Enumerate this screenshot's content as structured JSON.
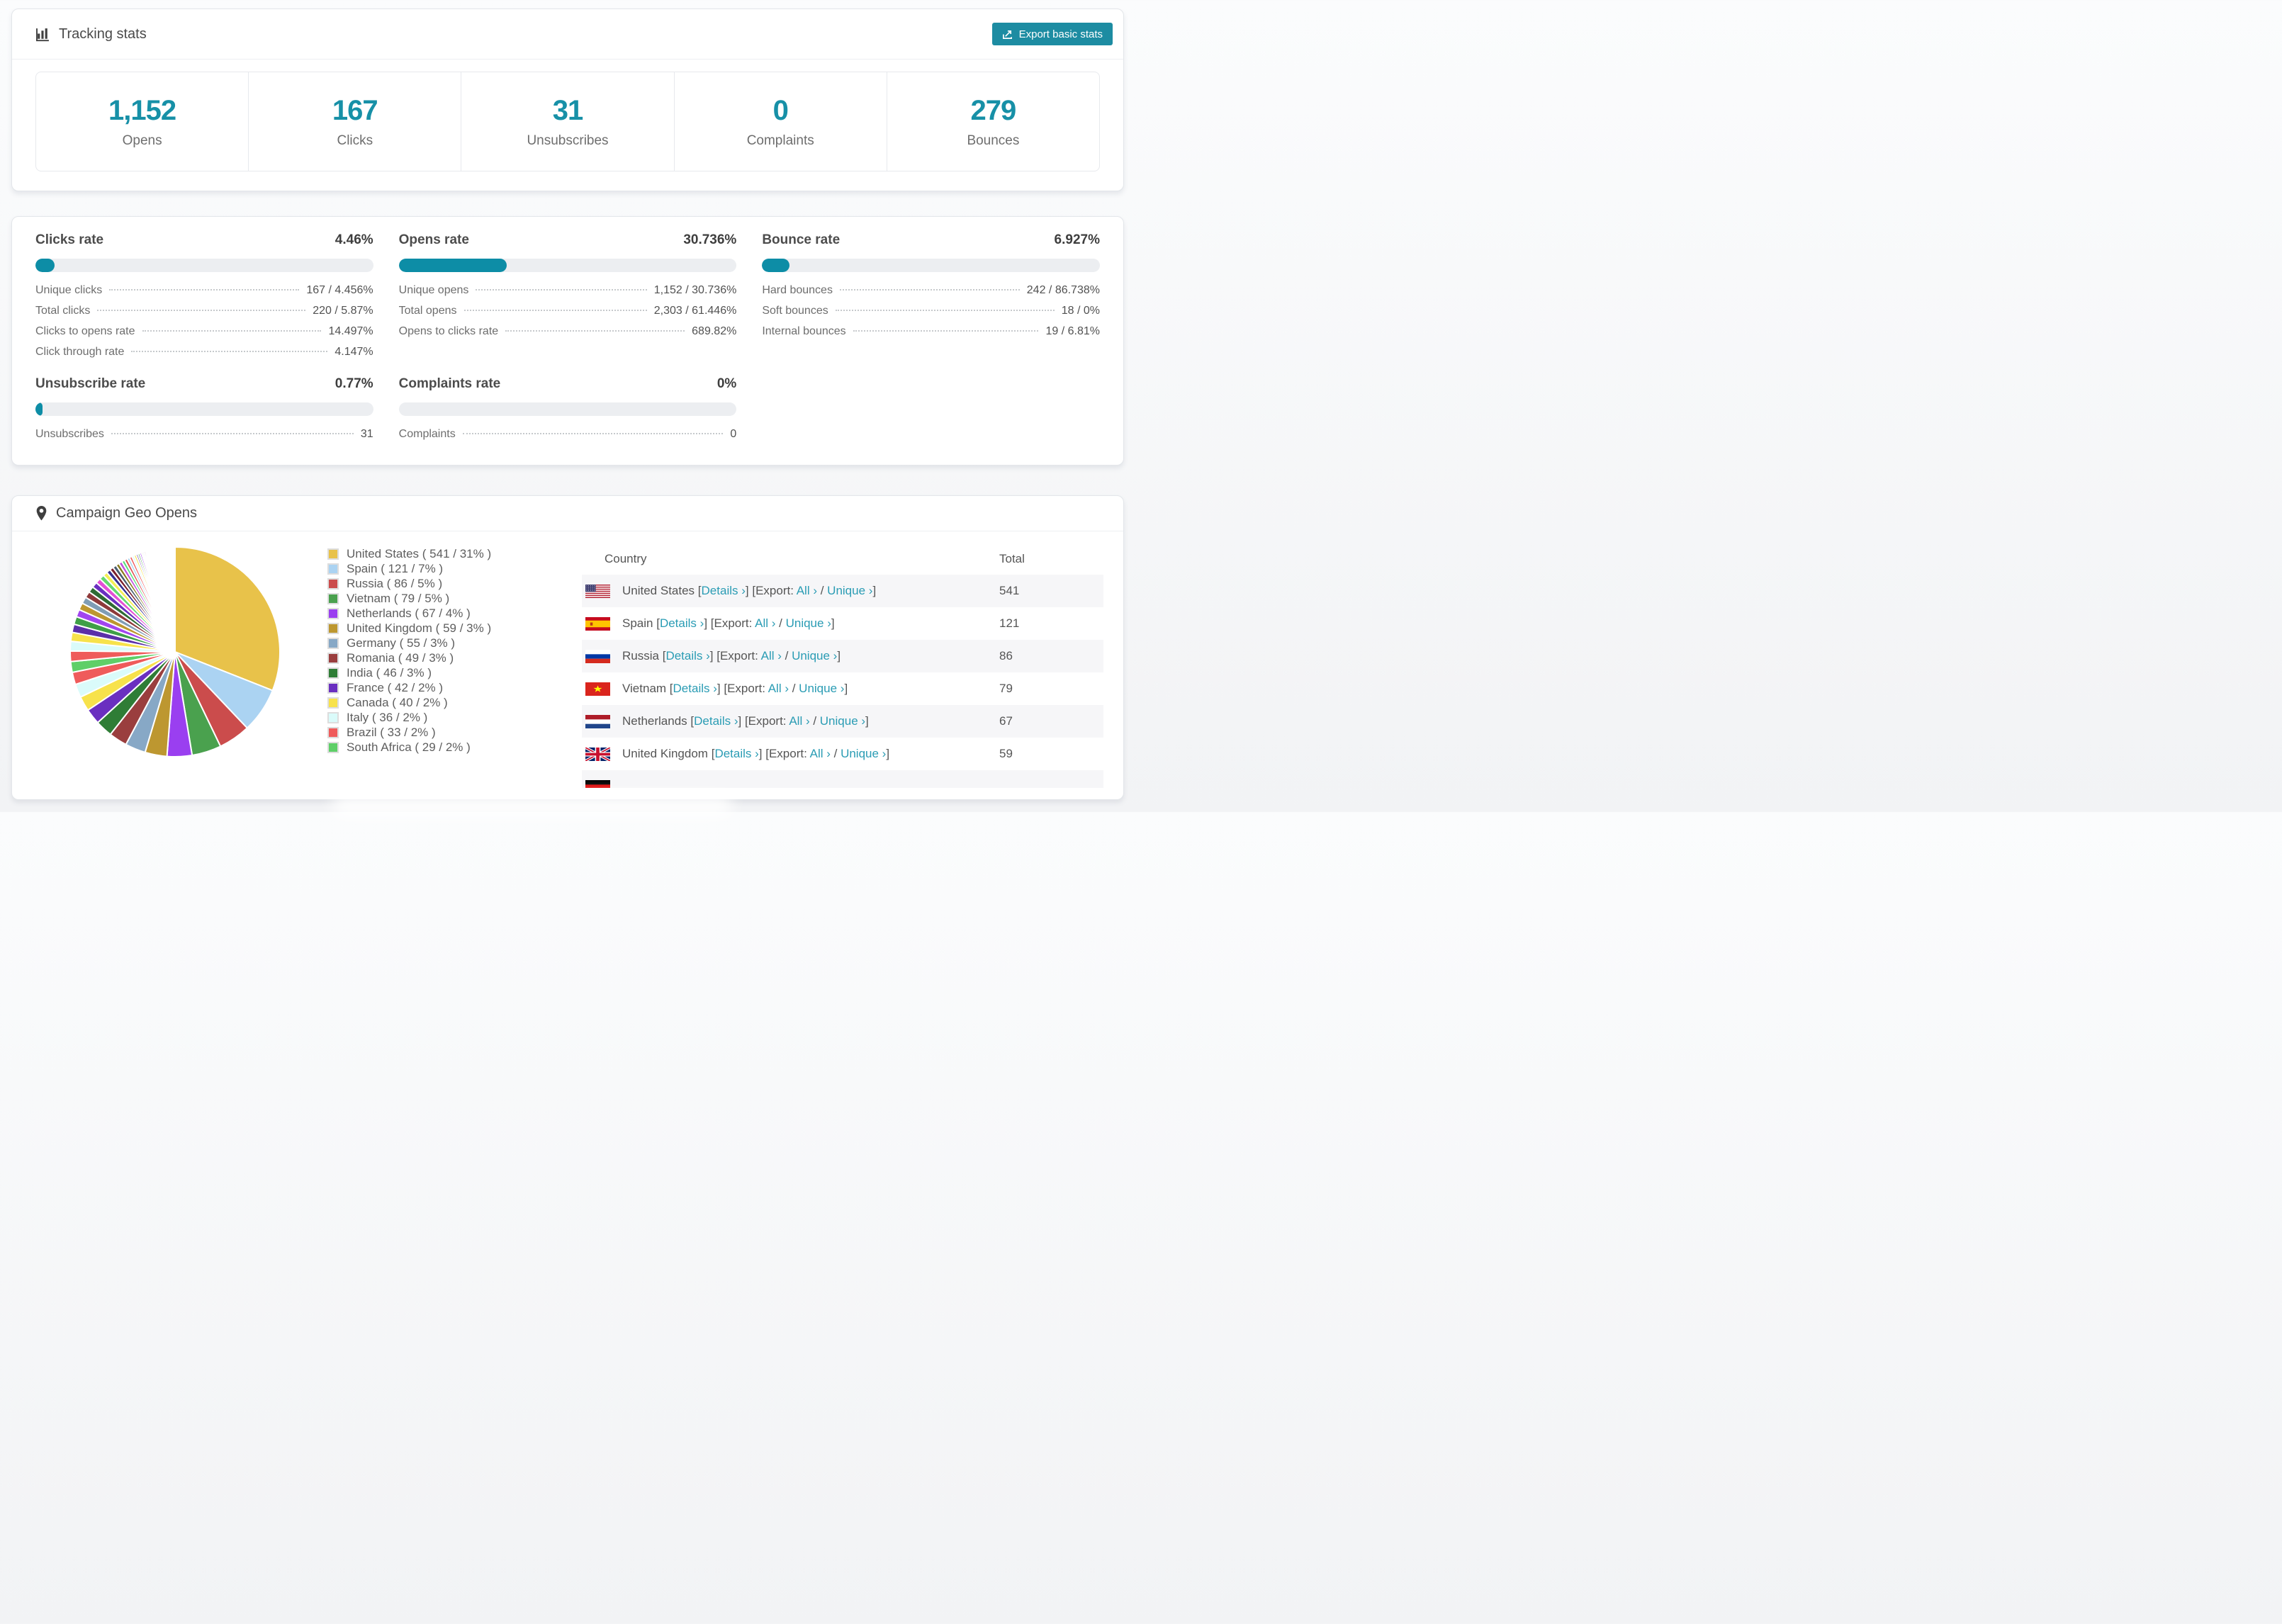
{
  "colors": {
    "accent": "#1790a7",
    "link": "#2a9cb4",
    "bar_fill": "#0d8da6",
    "bar_track": "#eceef1",
    "button_bg": "#1d8ca2",
    "row_alt_bg": "#f6f6f8"
  },
  "tracking": {
    "title": "Tracking stats",
    "export_button": {
      "label": "Export basic stats"
    },
    "summary": [
      {
        "value": "1,152",
        "label": "Opens"
      },
      {
        "value": "167",
        "label": "Clicks"
      },
      {
        "value": "31",
        "label": "Unsubscribes"
      },
      {
        "value": "0",
        "label": "Complaints"
      },
      {
        "value": "279",
        "label": "Bounces"
      }
    ]
  },
  "rates": [
    {
      "title": "Clicks rate",
      "value": "4.46%",
      "percent": 4.46,
      "rows": [
        {
          "label": "Unique clicks",
          "value": "167 / 4.456%"
        },
        {
          "label": "Total clicks",
          "value": "220 / 5.87%"
        },
        {
          "label": "Clicks to opens rate",
          "value": "14.497%"
        },
        {
          "label": "Click through rate",
          "value": "4.147%"
        }
      ]
    },
    {
      "title": "Opens rate",
      "value": "30.736%",
      "percent": 30.736,
      "rows": [
        {
          "label": "Unique opens",
          "value": "1,152 / 30.736%"
        },
        {
          "label": "Total opens",
          "value": "2,303 / 61.446%"
        },
        {
          "label": "Opens to clicks rate",
          "value": "689.82%"
        }
      ]
    },
    {
      "title": "Bounce rate",
      "value": "6.927%",
      "percent": 6.927,
      "rows": [
        {
          "label": "Hard bounces",
          "value": "242 / 86.738%"
        },
        {
          "label": "Soft bounces",
          "value": "18 / 0%"
        },
        {
          "label": "Internal bounces",
          "value": "19 / 6.81%"
        }
      ]
    },
    {
      "title": "Unsubscribe rate",
      "value": "0.77%",
      "percent": 0.77,
      "rows": [
        {
          "label": "Unsubscribes",
          "value": "31"
        }
      ]
    },
    {
      "title": "Complaints rate",
      "value": "0%",
      "percent": 0,
      "rows": [
        {
          "label": "Complaints",
          "value": "0"
        }
      ]
    }
  ],
  "geo": {
    "title": "Campaign Geo Opens",
    "legend": [
      {
        "label": "United States ( 541 / 31% )",
        "color": "#e8c24a"
      },
      {
        "label": "Spain ( 121 / 7% )",
        "color": "#abd3f2"
      },
      {
        "label": "Russia ( 86 / 5% )",
        "color": "#cb4c4c"
      },
      {
        "label": "Vietnam ( 79 / 5% )",
        "color": "#4aa14e"
      },
      {
        "label": "Netherlands ( 67 / 4% )",
        "color": "#9a3ff0"
      },
      {
        "label": "United Kingdom ( 59 / 3% )",
        "color": "#bd9730"
      },
      {
        "label": "Germany ( 55 / 3% )",
        "color": "#87a8c6"
      },
      {
        "label": "Romania ( 49 / 3% )",
        "color": "#9a3e3e"
      },
      {
        "label": "India ( 46 / 3% )",
        "color": "#2f7d36"
      },
      {
        "label": "France ( 42 / 2% )",
        "color": "#6a2fc0"
      },
      {
        "label": "Canada ( 40 / 2% )",
        "color": "#f7e24b"
      },
      {
        "label": "Italy ( 36 / 2% )",
        "color": "#dafbfa"
      },
      {
        "label": "Brazil ( 33 / 2% )",
        "color": "#ef5b5b"
      },
      {
        "label": "South Africa ( 29 / 2% )",
        "color": "#5ecf68"
      }
    ],
    "table": {
      "headers": [
        "Country",
        "Total"
      ],
      "link_labels": {
        "details": "Details",
        "export": "Export:",
        "all": "All",
        "unique": "Unique",
        "chevron": "›"
      },
      "rows": [
        {
          "country": "United States",
          "flag": "us",
          "total": "541"
        },
        {
          "country": "Spain",
          "flag": "es",
          "total": "121"
        },
        {
          "country": "Russia",
          "flag": "ru",
          "total": "86"
        },
        {
          "country": "Vietnam",
          "flag": "vn",
          "total": "79"
        },
        {
          "country": "Netherlands",
          "flag": "nl",
          "total": "67"
        },
        {
          "country": "United Kingdom",
          "flag": "gb",
          "total": "59"
        },
        {
          "country": "",
          "flag": "de",
          "total": "",
          "clipped": true
        }
      ]
    }
  },
  "chart_data": {
    "type": "pie",
    "title": "Campaign Geo Opens",
    "legend_position": "right",
    "start_angle_deg": -90,
    "direction": "clockwise",
    "labels": [
      "United States",
      "Spain",
      "Russia",
      "Vietnam",
      "Netherlands",
      "United Kingdom",
      "Germany",
      "Romania",
      "India",
      "France",
      "Canada",
      "Italy",
      "Brazil",
      "South Africa"
    ],
    "values": [
      541,
      121,
      86,
      79,
      67,
      59,
      55,
      49,
      46,
      42,
      40,
      36,
      33,
      29
    ],
    "percent_labels": [
      "31%",
      "7%",
      "5%",
      "5%",
      "4%",
      "3%",
      "3%",
      "3%",
      "3%",
      "2%",
      "2%",
      "2%",
      "2%",
      "2%"
    ],
    "colors": [
      "#e8c24a",
      "#abd3f2",
      "#cb4c4c",
      "#4aa14e",
      "#9a3ff0",
      "#bd9730",
      "#87a8c6",
      "#9a3e3e",
      "#2f7d36",
      "#6a2fc0",
      "#f7e24b",
      "#dafbfa",
      "#ef5b5b",
      "#5ecf68"
    ],
    "others_unlabeled": {
      "note": "remaining countries drawn as progressively thinner unlabeled slices",
      "values": [
        28,
        26,
        24,
        22,
        21,
        20,
        19,
        18,
        17,
        16,
        15,
        14,
        13,
        12,
        11,
        10,
        10,
        9,
        9,
        8,
        8,
        7,
        7,
        6,
        6,
        5,
        5,
        5,
        4,
        4,
        4,
        3,
        3,
        3,
        3,
        2,
        2,
        2,
        2,
        2,
        1,
        1,
        1,
        1,
        1,
        1,
        1,
        1
      ],
      "palette": [
        "#ef5b5b",
        "#dafbfa",
        "#f7e24b",
        "#5b2fa8",
        "#3f9f47",
        "#a245ef",
        "#bd9730",
        "#7f9db5",
        "#8e3a3a",
        "#2e6b34",
        "#6a2fc0",
        "#e44fd5",
        "#64d96e",
        "#f4ef53",
        "#35308f",
        "#7a1f2b",
        "#4a5d6e",
        "#8a7a1f",
        "#c050e0",
        "#55e07a",
        "#e05050",
        "#a7d4f0"
      ],
      "remainder_white": 49
    }
  }
}
